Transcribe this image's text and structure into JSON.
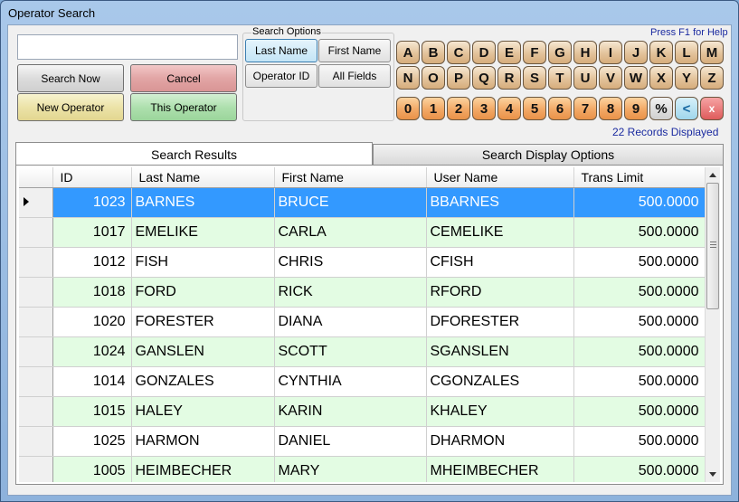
{
  "window": {
    "title": "Operator Search"
  },
  "search": {
    "value": "",
    "placeholder": ""
  },
  "buttons": {
    "search_now": "Search Now",
    "cancel": "Cancel",
    "new_operator": "New Operator",
    "this_operator": "This Operator"
  },
  "search_options": {
    "legend": "Search Options",
    "last_name": "Last Name",
    "first_name": "First Name",
    "operator_id": "Operator ID",
    "all_fields": "All Fields",
    "selected": "Last Name"
  },
  "help_text": "Press F1 for Help",
  "records_text": "22 Records Displayed",
  "keyboard": {
    "row1": [
      "A",
      "B",
      "C",
      "D",
      "E",
      "F",
      "G",
      "H",
      "I",
      "J",
      "K",
      "L",
      "M"
    ],
    "row2": [
      "N",
      "O",
      "P",
      "Q",
      "R",
      "S",
      "T",
      "U",
      "V",
      "W",
      "X",
      "Y",
      "Z"
    ],
    "row3": [
      "0",
      "1",
      "2",
      "3",
      "4",
      "5",
      "6",
      "7",
      "8",
      "9",
      "%",
      "<",
      "x"
    ]
  },
  "tabs": {
    "results": "Search Results",
    "display_options": "Search Display Options"
  },
  "grid": {
    "headers": [
      "ID",
      "Last Name",
      "First Name",
      "User Name",
      "Trans Limit"
    ],
    "rows": [
      {
        "id": "1023",
        "last": "BARNES",
        "first": "BRUCE",
        "user": "BBARNES",
        "limit": "500.0000"
      },
      {
        "id": "1017",
        "last": "EMELIKE",
        "first": "CARLA",
        "user": "CEMELIKE",
        "limit": "500.0000"
      },
      {
        "id": "1012",
        "last": "FISH",
        "first": "CHRIS",
        "user": "CFISH",
        "limit": "500.0000"
      },
      {
        "id": "1018",
        "last": "FORD",
        "first": "RICK",
        "user": "RFORD",
        "limit": "500.0000"
      },
      {
        "id": "1020",
        "last": "FORESTER",
        "first": "DIANA",
        "user": "DFORESTER",
        "limit": "500.0000"
      },
      {
        "id": "1024",
        "last": "GANSLEN",
        "first": "SCOTT",
        "user": "SGANSLEN",
        "limit": "500.0000"
      },
      {
        "id": "1014",
        "last": "GONZALES",
        "first": "CYNTHIA",
        "user": "CGONZALES",
        "limit": "500.0000"
      },
      {
        "id": "1015",
        "last": "HALEY",
        "first": "KARIN",
        "user": "KHALEY",
        "limit": "500.0000"
      },
      {
        "id": "1025",
        "last": "HARMON",
        "first": "DANIEL",
        "user": "DHARMON",
        "limit": "500.0000"
      },
      {
        "id": "1005",
        "last": "HEIMBECHER",
        "first": "MARY",
        "user": "MHEIMBECHER",
        "limit": "500.0000"
      }
    ],
    "selected_row": 0
  },
  "colors": {
    "selection": "#3399ff",
    "alt_row": "#e3fce3",
    "link_text": "#1a2aa0"
  }
}
